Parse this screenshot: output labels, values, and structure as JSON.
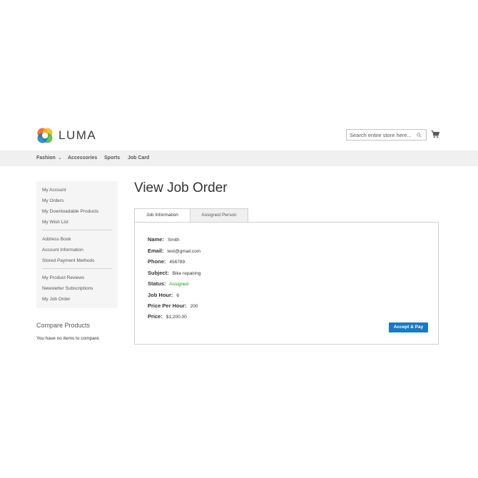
{
  "header": {
    "logo_text": "LUMA",
    "search_placeholder": "Search entire store here...",
    "colors": {
      "logo_orange": "#f26322",
      "logo_blue": "#1979c3",
      "logo_green": "#4cb748",
      "logo_yellow": "#f7b519"
    }
  },
  "nav": {
    "items": [
      {
        "label": "Fashion",
        "has_dropdown": true
      },
      {
        "label": "Accessories"
      },
      {
        "label": "Sports"
      },
      {
        "label": "Job Card"
      }
    ]
  },
  "sidebar": {
    "groups": [
      [
        "My Account",
        "My Orders",
        "My Downloadable Products",
        "My Wish List"
      ],
      [
        "Address Book",
        "Account Information",
        "Stored Payment Methods"
      ],
      [
        "My Product Reviews",
        "Newsletter Subscriptions",
        "My Job Order"
      ]
    ]
  },
  "compare": {
    "title": "Compare Products",
    "empty_text": "You have no items to compare."
  },
  "main": {
    "title": "View Job Order",
    "tabs": [
      {
        "label": "Job Information",
        "active": true
      },
      {
        "label": "Assigned Person",
        "active": false
      }
    ],
    "fields": [
      {
        "label": "Name:",
        "value": "Smith"
      },
      {
        "label": "Email:",
        "value": "test@gmail.com"
      },
      {
        "label": "Phone:",
        "value": "456789"
      },
      {
        "label": "Subject:",
        "value": "Bike repairing"
      },
      {
        "label": "Status:",
        "value": "Assigned",
        "color": "#1f9a1f"
      },
      {
        "label": "Job Hour:",
        "value": "6"
      },
      {
        "label": "Price Per Hour:",
        "value": "200"
      },
      {
        "label": "Price:",
        "value": "$1,200.00"
      }
    ],
    "pay_button": "Accept & Pay",
    "accent_color": "#1979c3"
  }
}
